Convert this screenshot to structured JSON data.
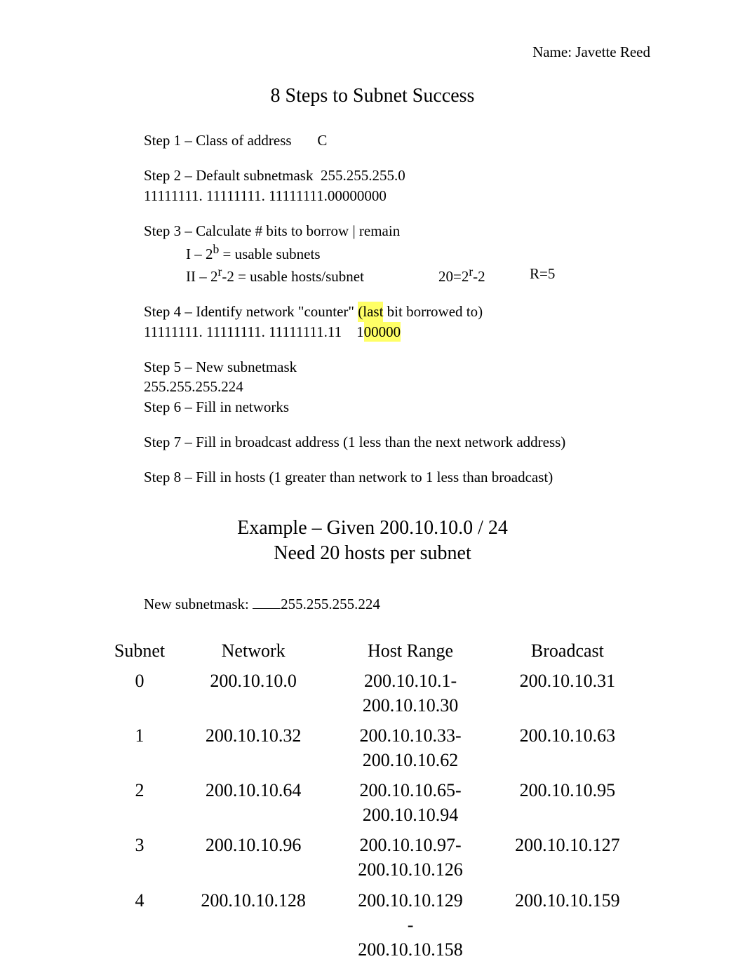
{
  "header": {
    "name_label": "Name:",
    "name_value": "Javette Reed"
  },
  "title": "8 Steps to Subnet Success",
  "steps": {
    "s1": {
      "label": "Step 1 – Class of address",
      "value": "C"
    },
    "s2": {
      "label": "Step 2 – Default subnetmask",
      "mask": "255.255.255.0",
      "binary": "11111111. 11111111. 11111111.00000000"
    },
    "s3": {
      "label": "Step 3 – Calculate # bits to borrow | remain",
      "line_i": "I – 2",
      "line_i_exp": "b",
      "line_i_after": " = usable subnets",
      "line_ii": "II – 2",
      "line_ii_exp": "r",
      "line_ii_after": "-2 = usable hosts/subnet",
      "calc_a": "20=2",
      "calc_a_exp": "r",
      "calc_a_after": "-2",
      "calc_b": "R=5"
    },
    "s4": {
      "label_a": "Step 4 – Identify network \"counter\" ",
      "label_b": "(last",
      "label_c": " bit borrowed to)",
      "binary_a": "11111111. 11111111. 11111111.11",
      "binary_gap": "     ",
      "binary_b": "1",
      "binary_c": "00000"
    },
    "s5": {
      "label": "Step 5 – New subnetmask",
      "mask": "255.255.255.224"
    },
    "s6": {
      "label": "Step 6 – Fill in networks"
    },
    "s7": {
      "label": "Step 7 – Fill in broadcast address (1 less than the next network address)"
    },
    "s8": {
      "label": "Step 8 – Fill in hosts (1 greater than network to 1 less than broadcast)"
    }
  },
  "example": {
    "line1": "Example – Given 200.10.10.0 / 24",
    "line2": "Need 20 hosts per subnet"
  },
  "new_mask": {
    "label": "New subnetmask:   ",
    "value": "255.255.255.224"
  },
  "table": {
    "headers": {
      "subnet": "Subnet",
      "network": "Network",
      "host_range": "Host Range",
      "broadcast": "Broadcast"
    },
    "rows": [
      {
        "subnet": "0",
        "network": "200.10.10.0",
        "host_a": "200.10.10.1-",
        "host_b": "200.10.10.30",
        "broadcast": "200.10.10.31"
      },
      {
        "subnet": "1",
        "network": "200.10.10.32",
        "host_a": "200.10.10.33-",
        "host_b": "200.10.10.62",
        "broadcast": "200.10.10.63"
      },
      {
        "subnet": "2",
        "network": "200.10.10.64",
        "host_a": "200.10.10.65-",
        "host_b": "200.10.10.94",
        "broadcast": "200.10.10.95"
      },
      {
        "subnet": "3",
        "network": "200.10.10.96",
        "host_a": "200.10.10.97-",
        "host_b": "200.10.10.126",
        "broadcast": "200.10.10.127"
      },
      {
        "subnet": "4",
        "network": "200.10.10.128",
        "host_a": "200.10.10.129",
        "host_dash": "-",
        "host_b": "200.10.10.158",
        "broadcast": "200.10.10.159"
      }
    ]
  }
}
